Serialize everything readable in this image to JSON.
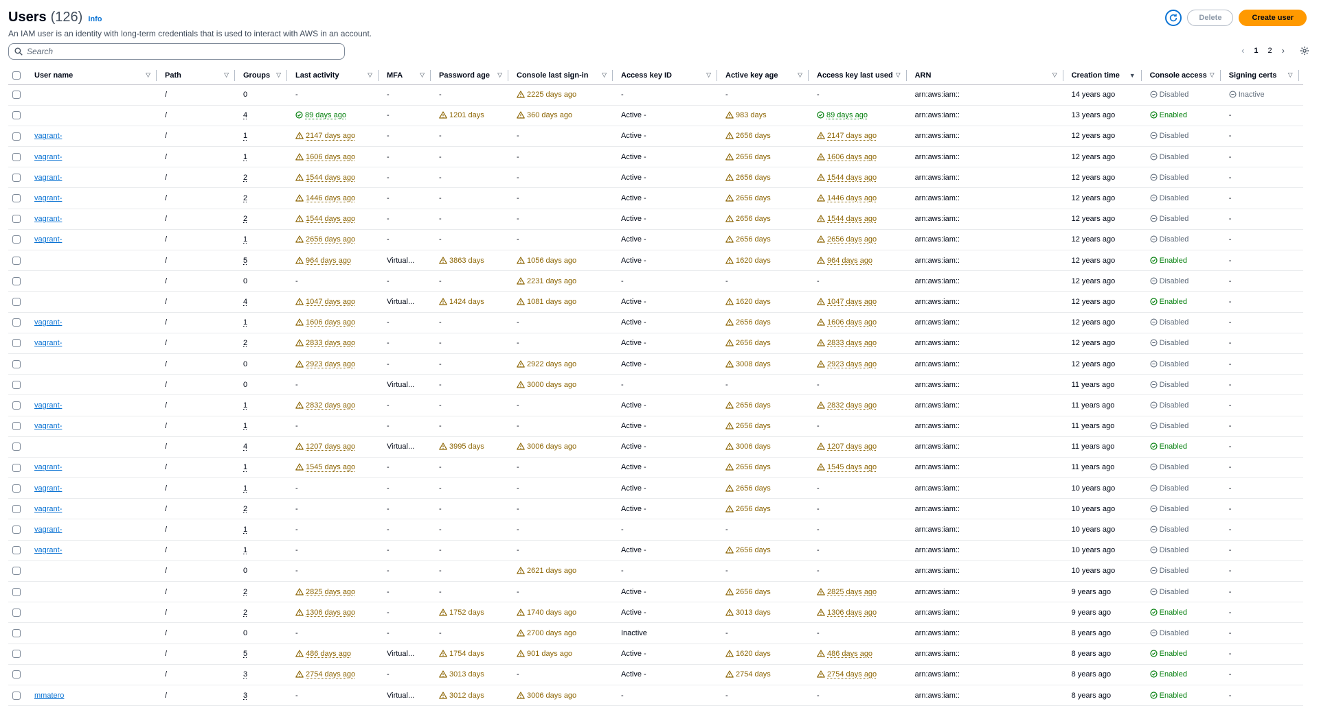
{
  "header": {
    "title": "Users",
    "count": "(126)",
    "info": "Info",
    "description": "An IAM user is an identity with long-term credentials that is used to interact with AWS in an account."
  },
  "actions": {
    "delete": "Delete",
    "create": "Create user"
  },
  "search": {
    "placeholder": "Search"
  },
  "pagination": {
    "pages": [
      "1",
      "2"
    ],
    "current": "1"
  },
  "columns": [
    "User name",
    "Path",
    "Groups",
    "Last activity",
    "MFA",
    "Password age",
    "Console last sign-in",
    "Access key ID",
    "Active key age",
    "Access key last used",
    "ARN",
    "Creation time",
    "Console access",
    "Signing certs"
  ],
  "colors": {
    "warning": "#8d6605",
    "success": "#037f0c",
    "link": "#0972d3",
    "accent": "#ff9900"
  },
  "rows": [
    [
      "",
      "/",
      "0",
      "-",
      "-",
      "-",
      "!2225 days ago",
      "-",
      "-",
      "-",
      "arn:aws:iam::",
      "14 years ago",
      "oDisabled",
      "oInactive"
    ],
    [
      "",
      "/",
      "4",
      "+89 days ago",
      "-",
      "!1201 days",
      "!360 days ago",
      "Active -",
      "!983 days",
      "+89 days ago",
      "arn:aws:iam::",
      "13 years ago",
      "+Enabled",
      "-"
    ],
    [
      "vagrant-",
      "/",
      "1",
      "!2147 days ago",
      "-",
      "-",
      "-",
      "Active -",
      "!2656 days",
      "!2147 days ago",
      "arn:aws:iam::",
      "12 years ago",
      "oDisabled",
      "-"
    ],
    [
      "vagrant-",
      "/",
      "1",
      "!1606 days ago",
      "-",
      "-",
      "-",
      "Active -",
      "!2656 days",
      "!1606 days ago",
      "arn:aws:iam::",
      "12 years ago",
      "oDisabled",
      "-"
    ],
    [
      "vagrant-",
      "/",
      "2",
      "!1544 days ago",
      "-",
      "-",
      "-",
      "Active -",
      "!2656 days",
      "!1544 days ago",
      "arn:aws:iam::",
      "12 years ago",
      "oDisabled",
      "-"
    ],
    [
      "vagrant-",
      "/",
      "2",
      "!1446 days ago",
      "-",
      "-",
      "-",
      "Active -",
      "!2656 days",
      "!1446 days ago",
      "arn:aws:iam::",
      "12 years ago",
      "oDisabled",
      "-"
    ],
    [
      "vagrant-",
      "/",
      "2",
      "!1544 days ago",
      "-",
      "-",
      "-",
      "Active -",
      "!2656 days",
      "!1544 days ago",
      "arn:aws:iam::",
      "12 years ago",
      "oDisabled",
      "-"
    ],
    [
      "vagrant-",
      "/",
      "1",
      "!2656 days ago",
      "-",
      "-",
      "-",
      "Active -",
      "!2656 days",
      "!2656 days ago",
      "arn:aws:iam::",
      "12 years ago",
      "oDisabled",
      "-"
    ],
    [
      "",
      "/",
      "5",
      "!964 days ago",
      "Virtual...",
      "!3863 days",
      "!1056 days ago",
      "Active -",
      "!1620 days",
      "!964 days ago",
      "arn:aws:iam::",
      "12 years ago",
      "+Enabled",
      "-"
    ],
    [
      "",
      "/",
      "0",
      "-",
      "-",
      "-",
      "!2231 days ago",
      "-",
      "-",
      "-",
      "arn:aws:iam::",
      "12 years ago",
      "oDisabled",
      "-"
    ],
    [
      "",
      "/",
      "4",
      "!1047 days ago",
      "Virtual...",
      "!1424 days",
      "!1081 days ago",
      "Active -",
      "!1620 days",
      "!1047 days ago",
      "arn:aws:iam::",
      "12 years ago",
      "+Enabled",
      "-"
    ],
    [
      "vagrant-",
      "/",
      "1",
      "!1606 days ago",
      "-",
      "-",
      "-",
      "Active -",
      "!2656 days",
      "!1606 days ago",
      "arn:aws:iam::",
      "12 years ago",
      "oDisabled",
      "-"
    ],
    [
      "vagrant-",
      "/",
      "2",
      "!2833 days ago",
      "-",
      "-",
      "-",
      "Active -",
      "!2656 days",
      "!2833 days ago",
      "arn:aws:iam::",
      "12 years ago",
      "oDisabled",
      "-"
    ],
    [
      "",
      "/",
      "0",
      "!2923 days ago",
      "-",
      "-",
      "!2922 days ago",
      "Active -",
      "!3008 days",
      "!2923 days ago",
      "arn:aws:iam::",
      "12 years ago",
      "oDisabled",
      "-"
    ],
    [
      "",
      "/",
      "0",
      "-",
      "Virtual...",
      "-",
      "!3000 days ago",
      "-",
      "-",
      "-",
      "arn:aws:iam::",
      "11 years ago",
      "oDisabled",
      "-"
    ],
    [
      "vagrant-",
      "/",
      "1",
      "!2832 days ago",
      "-",
      "-",
      "-",
      "Active -",
      "!2656 days",
      "!2832 days ago",
      "arn:aws:iam::",
      "11 years ago",
      "oDisabled",
      "-"
    ],
    [
      "vagrant-",
      "/",
      "1",
      "-",
      "-",
      "-",
      "-",
      "Active -",
      "!2656 days",
      "-",
      "arn:aws:iam::",
      "11 years ago",
      "oDisabled",
      "-"
    ],
    [
      "",
      "/",
      "4",
      "!1207 days ago",
      "Virtual...",
      "!3995 days",
      "!3006 days ago",
      "Active -",
      "!3006 days",
      "!1207 days ago",
      "arn:aws:iam::",
      "11 years ago",
      "+Enabled",
      "-"
    ],
    [
      "vagrant-",
      "/",
      "1",
      "!1545 days ago",
      "-",
      "-",
      "-",
      "Active -",
      "!2656 days",
      "!1545 days ago",
      "arn:aws:iam::",
      "11 years ago",
      "oDisabled",
      "-"
    ],
    [
      "vagrant-",
      "/",
      "1",
      "-",
      "-",
      "-",
      "-",
      "Active -",
      "!2656 days",
      "-",
      "arn:aws:iam::",
      "10 years ago",
      "oDisabled",
      "-"
    ],
    [
      "vagrant-",
      "/",
      "2",
      "-",
      "-",
      "-",
      "-",
      "Active -",
      "!2656 days",
      "-",
      "arn:aws:iam::",
      "10 years ago",
      "oDisabled",
      "-"
    ],
    [
      "vagrant-",
      "/",
      "1",
      "-",
      "-",
      "-",
      "-",
      "-",
      "-",
      "-",
      "arn:aws:iam::",
      "10 years ago",
      "oDisabled",
      "-"
    ],
    [
      "vagrant-",
      "/",
      "1",
      "-",
      "-",
      "-",
      "-",
      "Active -",
      "!2656 days",
      "-",
      "arn:aws:iam::",
      "10 years ago",
      "oDisabled",
      "-"
    ],
    [
      "",
      "/",
      "0",
      "-",
      "-",
      "-",
      "!2621 days ago",
      "-",
      "-",
      "-",
      "arn:aws:iam::",
      "10 years ago",
      "oDisabled",
      "-"
    ],
    [
      "",
      "/",
      "2",
      "!2825 days ago",
      "-",
      "-",
      "-",
      "Active -",
      "!2656 days",
      "!2825 days ago",
      "arn:aws:iam::",
      "9 years ago",
      "oDisabled",
      "-"
    ],
    [
      "",
      "/",
      "2",
      "!1306 days ago",
      "-",
      "!1752 days",
      "!1740 days ago",
      "Active -",
      "!3013 days",
      "!1306 days ago",
      "arn:aws:iam::",
      "9 years ago",
      "+Enabled",
      "-"
    ],
    [
      "",
      "/",
      "0",
      "-",
      "-",
      "-",
      "!2700 days ago",
      "Inactive",
      "-",
      "-",
      "arn:aws:iam::",
      "8 years ago",
      "oDisabled",
      "-"
    ],
    [
      "",
      "/",
      "5",
      "!486 days ago",
      "Virtual...",
      "!1754 days",
      "!901 days ago",
      "Active -",
      "!1620 days",
      "!486 days ago",
      "arn:aws:iam::",
      "8 years ago",
      "+Enabled",
      "-"
    ],
    [
      "",
      "/",
      "3",
      "!2754 days ago",
      "-",
      "!3013 days",
      "-",
      "Active -",
      "!2754 days",
      "!2754 days ago",
      "arn:aws:iam::",
      "8 years ago",
      "+Enabled",
      "-"
    ],
    [
      "mmatero",
      "/",
      "3",
      "-",
      "Virtual...",
      "!3012 days",
      "!3006 days ago",
      "-",
      "-",
      "-",
      "arn:aws:iam::",
      "8 years ago",
      "+Enabled",
      "-"
    ]
  ]
}
